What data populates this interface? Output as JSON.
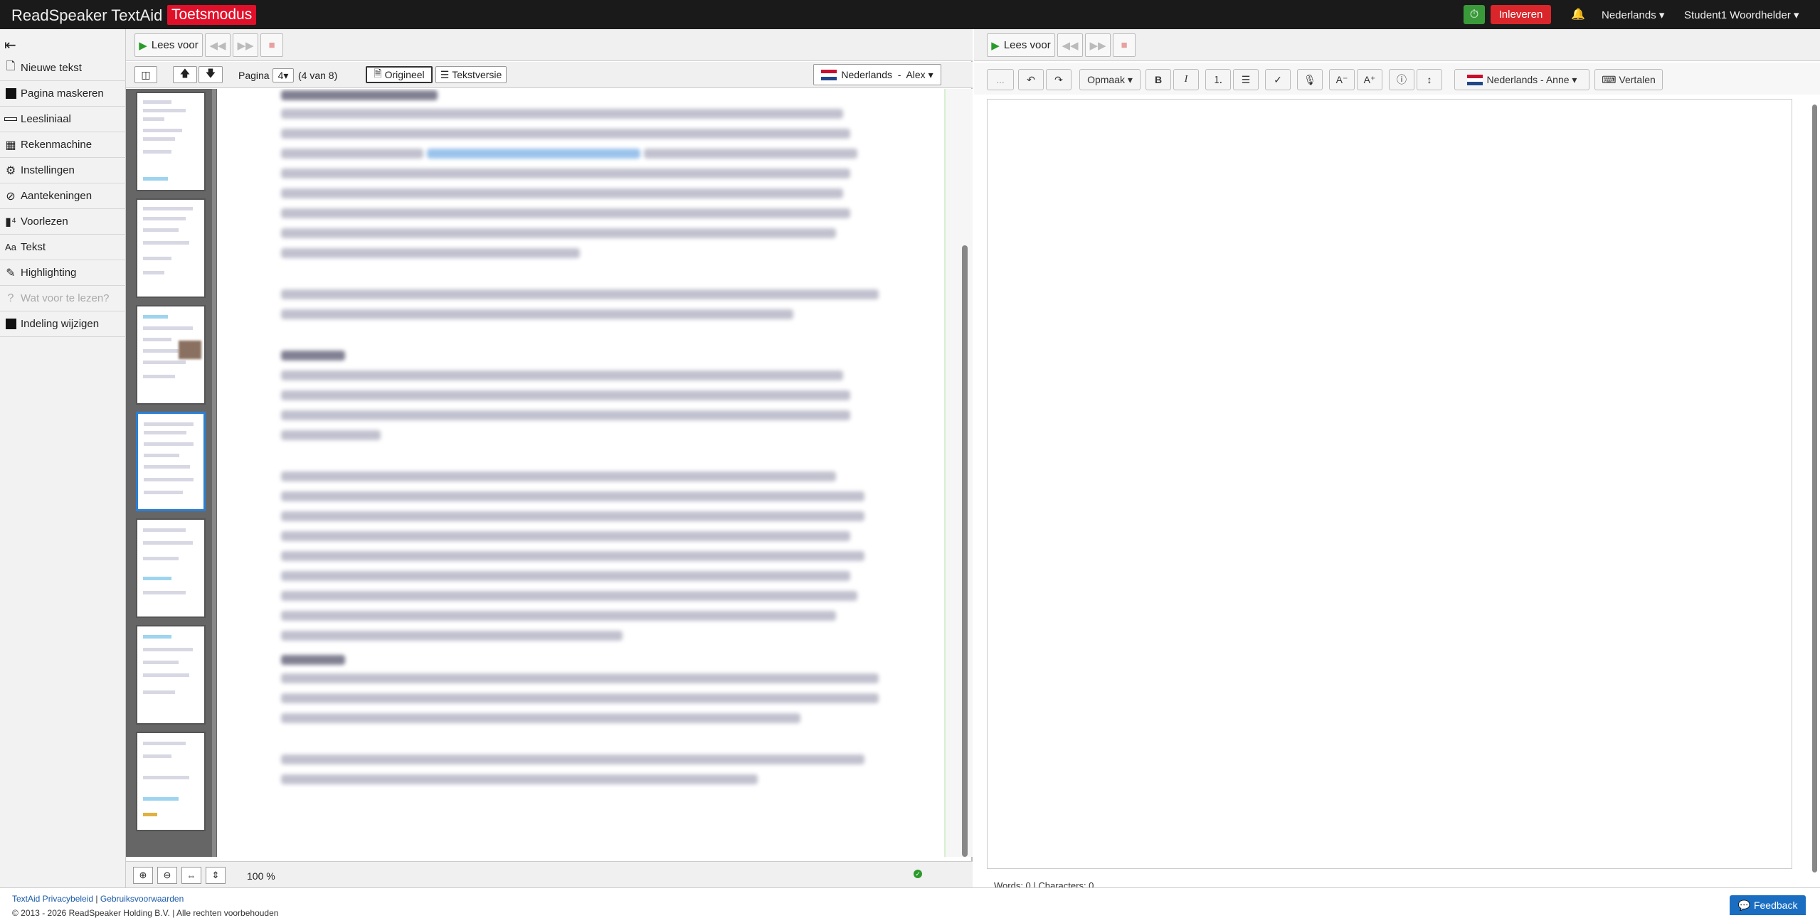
{
  "topbar": {
    "brand": "ReadSpeaker TextAid",
    "mode": "Toetsmodus",
    "submit": "Inleveren",
    "language": "Nederlands",
    "user": "Student1 Woordhelder",
    "colors": {
      "mode": "#e0102a",
      "submit": "#d9262b",
      "timer": "#3a9a3a"
    }
  },
  "sidebar": {
    "items": [
      {
        "label": "Nieuwe tekst",
        "icon": "document-icon"
      },
      {
        "label": "Pagina maskeren",
        "icon": "mask-icon"
      },
      {
        "label": "Leesliniaal",
        "icon": "ruler-icon"
      },
      {
        "label": "Rekenmachine",
        "icon": "calculator-icon"
      },
      {
        "label": "Instellingen",
        "icon": "gear-icon"
      },
      {
        "label": "Aantekeningen",
        "icon": "annotation-icon"
      },
      {
        "label": "Voorlezen",
        "icon": "speaker-icon"
      },
      {
        "label": "Tekst",
        "icon": "text-icon"
      },
      {
        "label": "Highlighting",
        "icon": "highlighter-icon"
      },
      {
        "label": "Wat voor te lezen?",
        "icon": "question-icon",
        "disabled": true
      },
      {
        "label": "Indeling wijzigen",
        "icon": "layout-icon"
      }
    ]
  },
  "doc": {
    "read_label": "Lees voor",
    "page_label": "Pagina",
    "page_value": "4",
    "page_of": "(4 van 8)",
    "original": "Origineel",
    "textversion": "Tekstversie",
    "voice": "Nederlands  -  Alex",
    "zoom": "100 %"
  },
  "editor": {
    "read_label": "Lees voor",
    "more": "...",
    "format": "Opmaak",
    "voice": "Nederlands - Anne",
    "translate": "Vertalen",
    "wordcount": "Words: 0 | Characters: 0"
  },
  "footer": {
    "privacy": "TextAid Privacybeleid",
    "sep": " | ",
    "terms": "Gebruiksvoorwaarden",
    "copyright": "© 2013 - 2026 ReadSpeaker Holding B.V. | Alle rechten voorbehouden",
    "feedback": "Feedback"
  }
}
